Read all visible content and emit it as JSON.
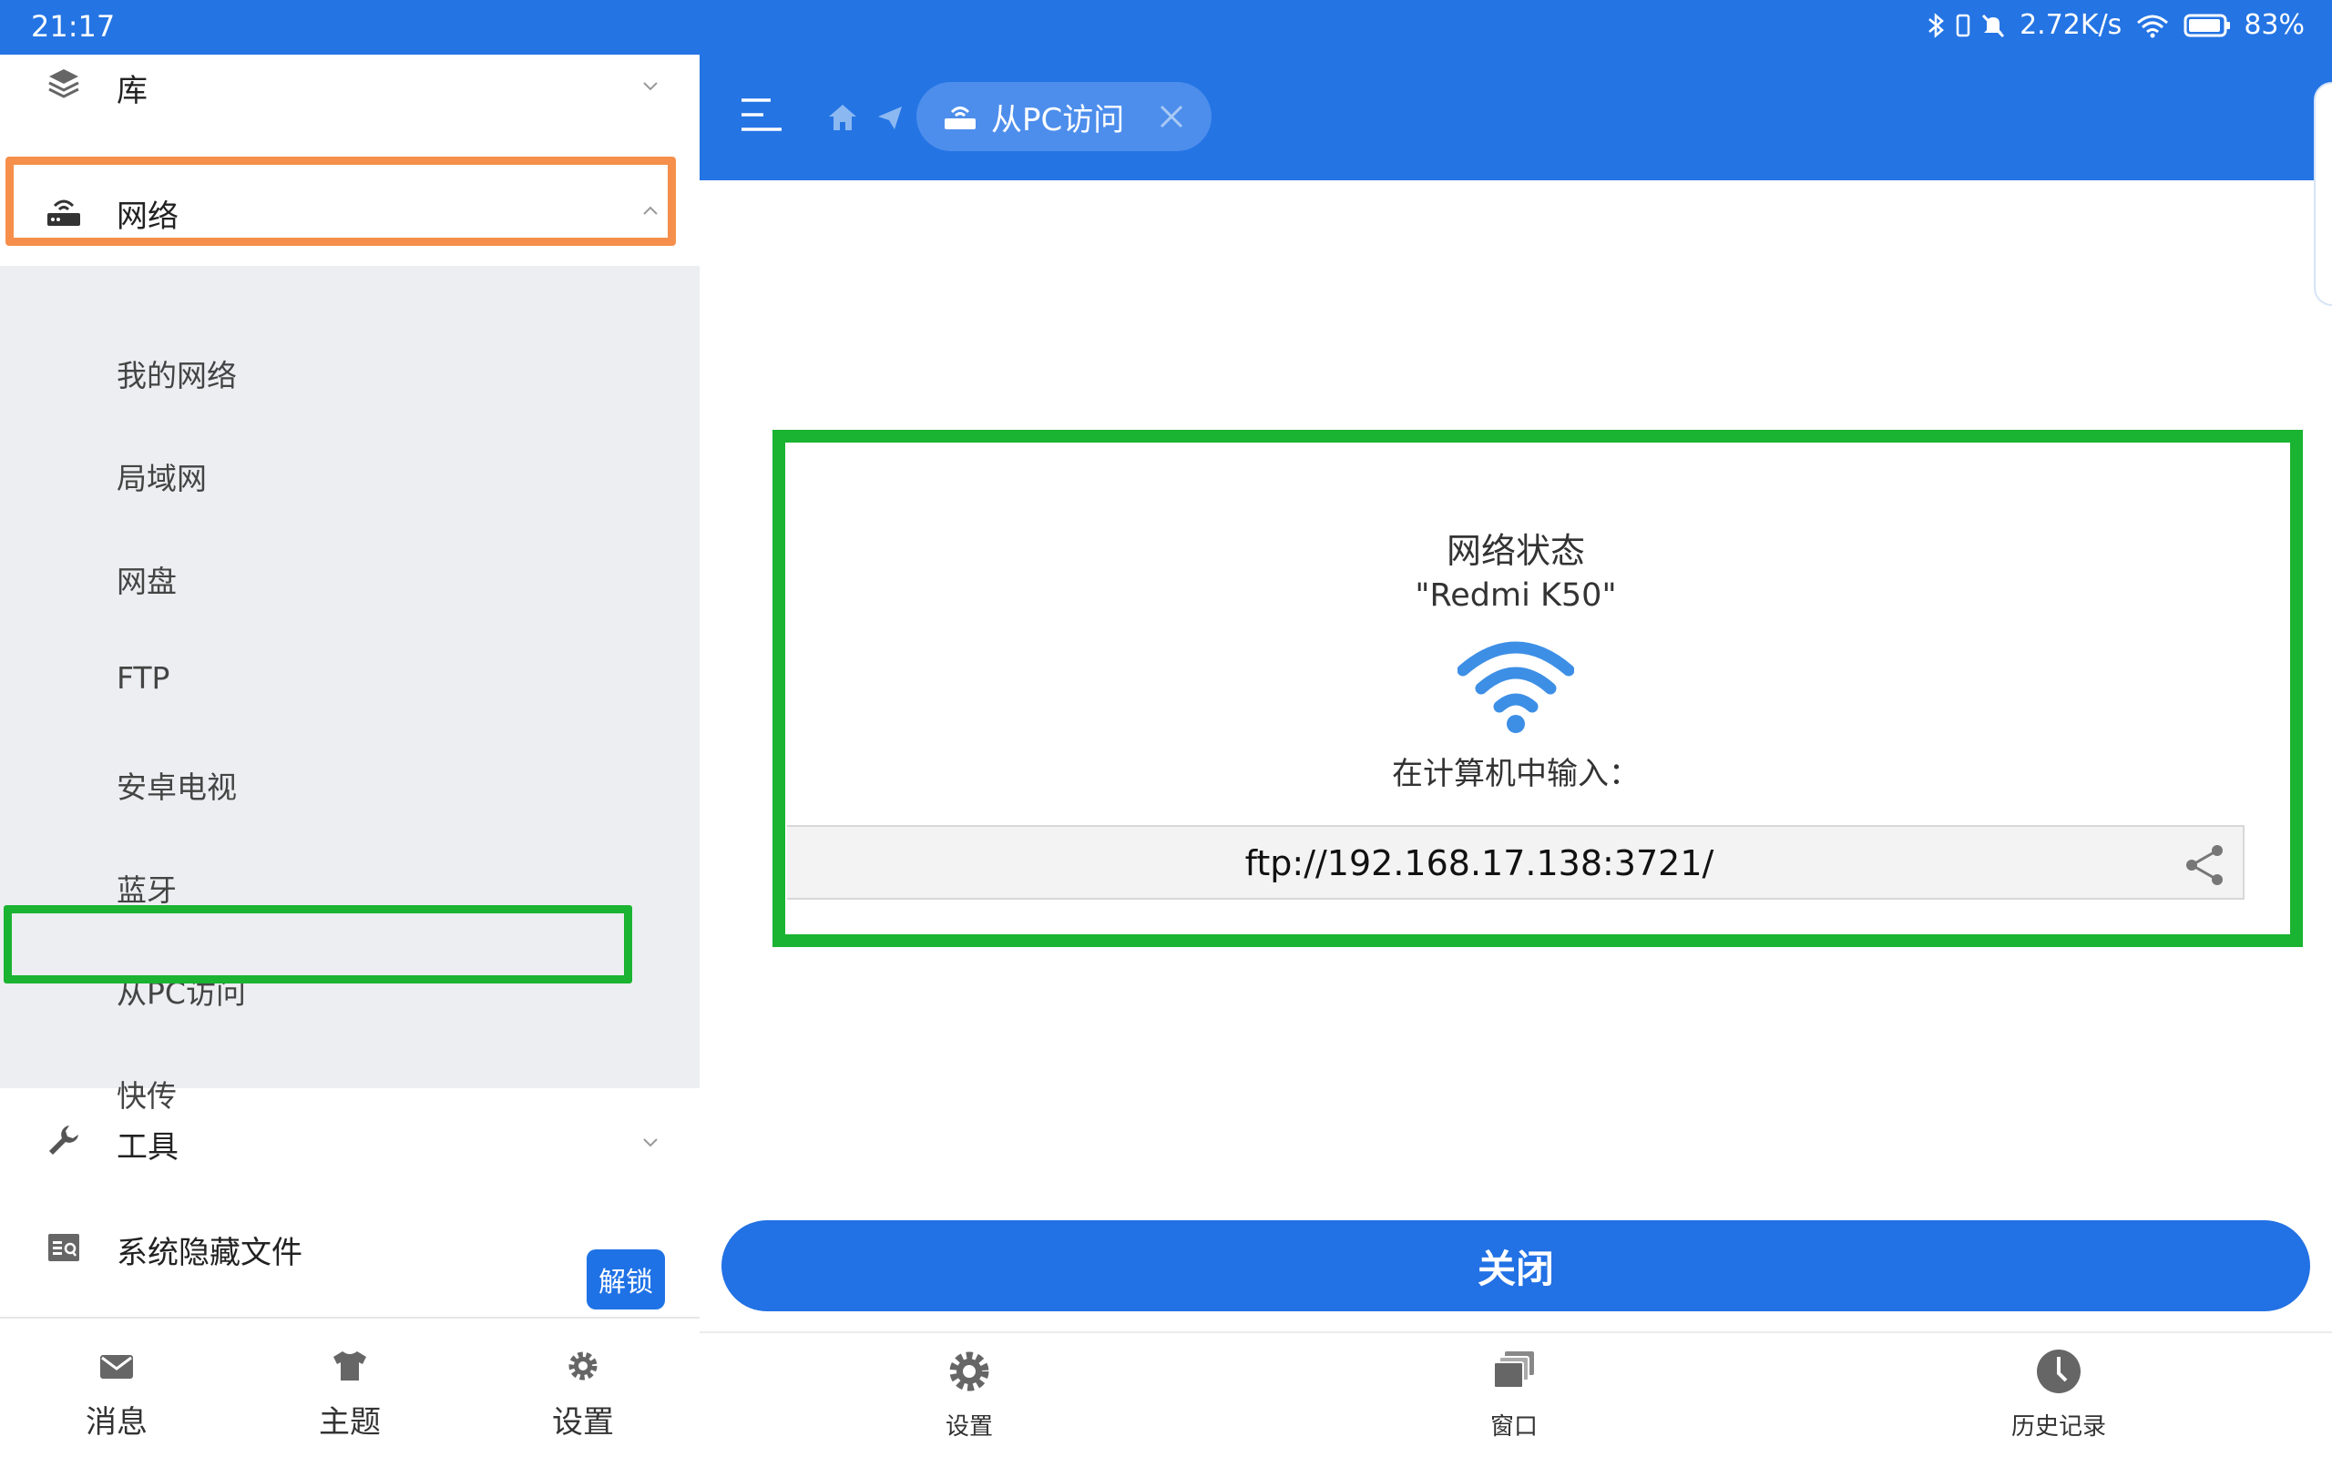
{
  "status_bar": {
    "time": "21:17",
    "net_speed": "2.72K/s",
    "battery": "83%"
  },
  "sidebar": {
    "library_label": "库",
    "network_label": "网络",
    "network_items": [
      "我的网络",
      "局域网",
      "网盘",
      "FTP",
      "安卓电视",
      "蓝牙",
      "从PC访问",
      "快传"
    ],
    "tools_label": "工具",
    "hidden_files_label": "系统隐藏文件",
    "unlock_label": "解锁",
    "bottom_nav": [
      "消息",
      "主题",
      "设置"
    ]
  },
  "topbar": {
    "active_tab_label": "从PC访问"
  },
  "card": {
    "title": "网络状态",
    "device_name": "\"Redmi K50\"",
    "hint": "在计算机中输入：",
    "url": "ftp://192.168.17.138:3721/"
  },
  "close_button": "关闭",
  "bottom_nav": [
    "设置",
    "窗口",
    "历史记录"
  ],
  "colors": {
    "primary": "#2474e4",
    "highlight_orange": "#f58f4b",
    "highlight_green": "#1ab332",
    "wifi_icon": "#3d8fe6"
  }
}
